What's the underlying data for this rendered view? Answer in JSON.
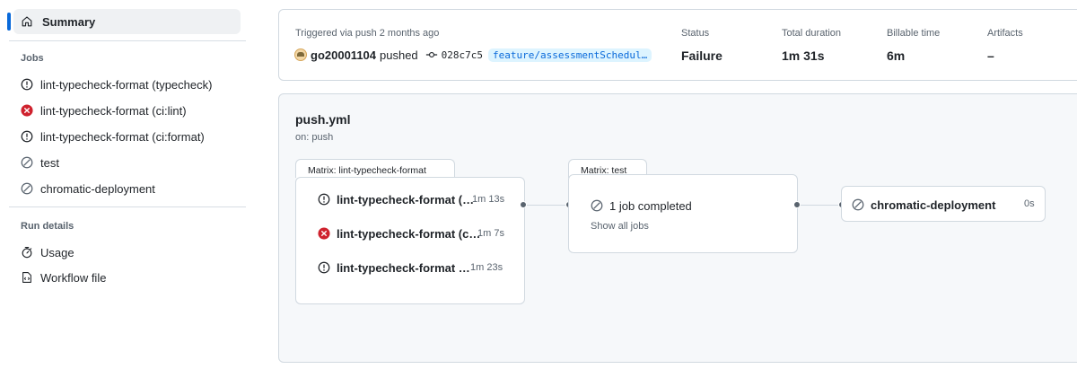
{
  "sidebar": {
    "summary_label": "Summary",
    "jobs_title": "Jobs",
    "jobs": [
      {
        "label": "lint-typecheck-format (typecheck)",
        "status": "warning"
      },
      {
        "label": "lint-typecheck-format (ci:lint)",
        "status": "failure"
      },
      {
        "label": "lint-typecheck-format (ci:format)",
        "status": "warning"
      },
      {
        "label": "test",
        "status": "skipped"
      },
      {
        "label": "chromatic-deployment",
        "status": "skipped"
      }
    ],
    "run_details_title": "Run details",
    "run_details": [
      {
        "label": "Usage",
        "icon": "stopwatch-icon"
      },
      {
        "label": "Workflow file",
        "icon": "file-icon"
      }
    ]
  },
  "summary": {
    "trigger_text": "Triggered via push 2 months ago",
    "user": "go20001104",
    "action": "pushed",
    "commit": "028c7c5",
    "branch": "feature/assessmentSchedul…",
    "status_label": "Status",
    "status_value": "Failure",
    "duration_label": "Total duration",
    "duration_value": "1m 31s",
    "billable_label": "Billable time",
    "billable_value": "6m",
    "artifacts_label": "Artifacts",
    "artifacts_value": "–"
  },
  "graph": {
    "workflow_file": "push.yml",
    "trigger": "on: push",
    "matrix1": {
      "title": "Matrix: lint-typecheck-format",
      "jobs": [
        {
          "label": "lint-typecheck-format (…",
          "duration": "1m 13s",
          "status": "warning"
        },
        {
          "label": "lint-typecheck-format (c…",
          "duration": "1m 7s",
          "status": "failure"
        },
        {
          "label": "lint-typecheck-format …",
          "duration": "1m 23s",
          "status": "warning"
        }
      ]
    },
    "matrix2": {
      "title": "Matrix: test",
      "summary": "1 job completed",
      "show_all": "Show all jobs"
    },
    "deploy": {
      "label": "chromatic-deployment",
      "duration": "0s"
    }
  },
  "colors": {
    "accent": "#0969da",
    "failure": "#cf222e",
    "muted": "#59636e"
  }
}
